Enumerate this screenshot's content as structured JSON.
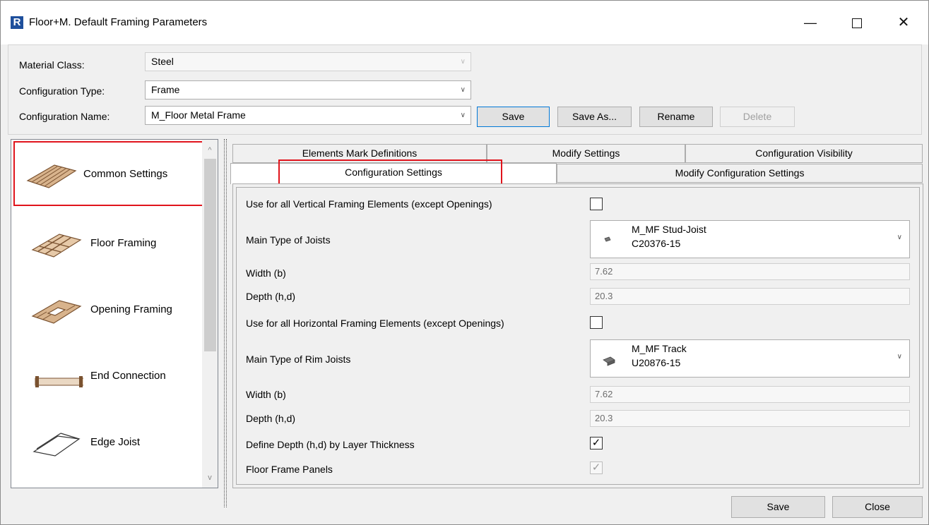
{
  "window": {
    "app_icon": "R",
    "title": "Floor+M. Default Framing Parameters",
    "minimize_glyph": "—",
    "close_glyph": "✕"
  },
  "top": {
    "material_class_label": "Material Class:",
    "material_class_value": "Steel",
    "config_type_label": "Configuration Type:",
    "config_type_value": "Frame",
    "config_name_label": "Configuration Name:",
    "config_name_value": "M_Floor Metal Frame",
    "buttons": {
      "save": "Save",
      "save_as": "Save As...",
      "rename": "Rename",
      "delete": "Delete"
    }
  },
  "sidebar": {
    "items": [
      {
        "label": "Common Settings",
        "icon": "common-settings-icon"
      },
      {
        "label": "Floor Framing",
        "icon": "floor-framing-icon"
      },
      {
        "label": "Opening Framing",
        "icon": "opening-framing-icon"
      },
      {
        "label": "End Connection",
        "icon": "end-connection-icon"
      },
      {
        "label": "Edge Joist",
        "icon": "edge-joist-icon"
      }
    ],
    "scroll_up_glyph": "^",
    "scroll_down_glyph": "v"
  },
  "tabs": {
    "row1": [
      "Elements Mark Definitions",
      "Modify Settings",
      "Configuration Visibility"
    ],
    "row2": [
      "Configuration Settings",
      "Modify Configuration Settings"
    ]
  },
  "settings": {
    "use_vertical_label": "Use for all Vertical Framing Elements (except Openings)",
    "use_vertical_checked": "",
    "main_joist_label": "Main Type of Joists",
    "main_joist_family": "M_MF Stud-Joist",
    "main_joist_type": "C20376-15",
    "width1_label": "Width (b)",
    "width1_value": "7.62",
    "depth1_label": "Depth (h,d)",
    "depth1_value": "20.3",
    "use_horizontal_label": "Use for all Horizontal Framing Elements (except Openings)",
    "use_horizontal_checked": "",
    "rim_joist_label": "Main Type of Rim Joists",
    "rim_joist_family": "M_MF Track",
    "rim_joist_type": "U20876-15",
    "width2_label": "Width (b)",
    "width2_value": "7.62",
    "depth2_label": "Depth (h,d)",
    "depth2_value": "20.3",
    "define_depth_label": "Define Depth (h,d) by Layer Thickness",
    "define_depth_checked": "✓",
    "floor_frame_panels_label": "Floor Frame Panels",
    "floor_frame_panels_checked": "✓"
  },
  "footer": {
    "save": "Save",
    "close": "Close"
  },
  "colors": {
    "highlight": "#e0141c",
    "focus": "#0078d7",
    "wood": "#b5835a"
  }
}
